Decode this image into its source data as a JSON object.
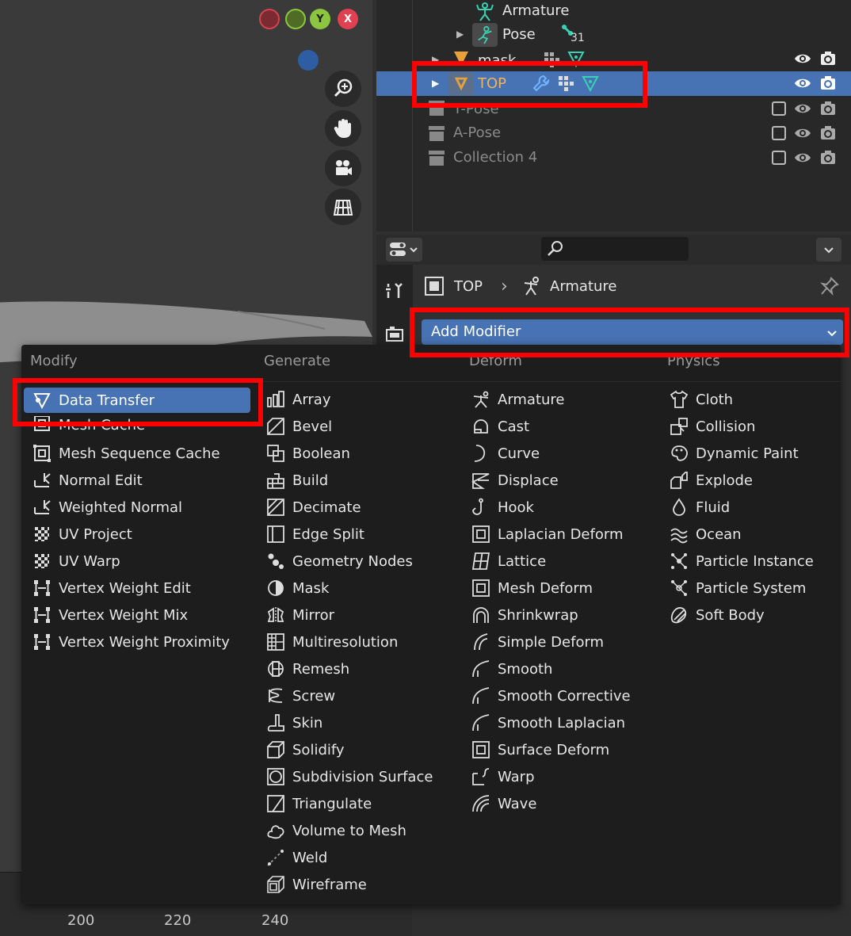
{
  "viewport": {
    "gizmo": {
      "y_label": "Y",
      "x_label": "X"
    },
    "timeline_ticks": [
      "200",
      "220",
      "240"
    ]
  },
  "outliner": {
    "rows": [
      {
        "label": "Armature",
        "badge": ""
      },
      {
        "label": "Pose",
        "badge": "31"
      },
      {
        "label": "mask",
        "badge": ""
      },
      {
        "label": "TOP",
        "badge": ""
      },
      {
        "label": "T-Pose",
        "badge": ""
      },
      {
        "label": "A-Pose",
        "badge": ""
      },
      {
        "label": "Collection 4",
        "badge": ""
      }
    ]
  },
  "properties": {
    "breadcrumb_object": "TOP",
    "breadcrumb_data": "Armature",
    "add_modifier_label": "Add Modifier"
  },
  "menu": {
    "columns": [
      {
        "header": "Modify",
        "items": [
          "Data Transfer",
          "Mesh Cache",
          "Mesh Sequence Cache",
          "Normal Edit",
          "Weighted Normal",
          "UV Project",
          "UV Warp",
          "Vertex Weight Edit",
          "Vertex Weight Mix",
          "Vertex Weight Proximity"
        ]
      },
      {
        "header": "Generate",
        "items": [
          "Array",
          "Bevel",
          "Boolean",
          "Build",
          "Decimate",
          "Edge Split",
          "Geometry Nodes",
          "Mask",
          "Mirror",
          "Multiresolution",
          "Remesh",
          "Screw",
          "Skin",
          "Solidify",
          "Subdivision Surface",
          "Triangulate",
          "Volume to Mesh",
          "Weld",
          "Wireframe"
        ]
      },
      {
        "header": "Deform",
        "items": [
          "Armature",
          "Cast",
          "Curve",
          "Displace",
          "Hook",
          "Laplacian Deform",
          "Lattice",
          "Mesh Deform",
          "Shrinkwrap",
          "Simple Deform",
          "Smooth",
          "Smooth Corrective",
          "Smooth Laplacian",
          "Surface Deform",
          "Warp",
          "Wave"
        ]
      },
      {
        "header": "Physics",
        "items": [
          "Cloth",
          "Collision",
          "Dynamic Paint",
          "Explode",
          "Fluid",
          "Ocean",
          "Particle Instance",
          "Particle System",
          "Soft Body"
        ]
      }
    ]
  },
  "colors": {
    "accent": "#4772b3",
    "highlight_box": "#ff0000",
    "object_orange": "#e8a13a",
    "data_teal": "#39d1b4"
  }
}
